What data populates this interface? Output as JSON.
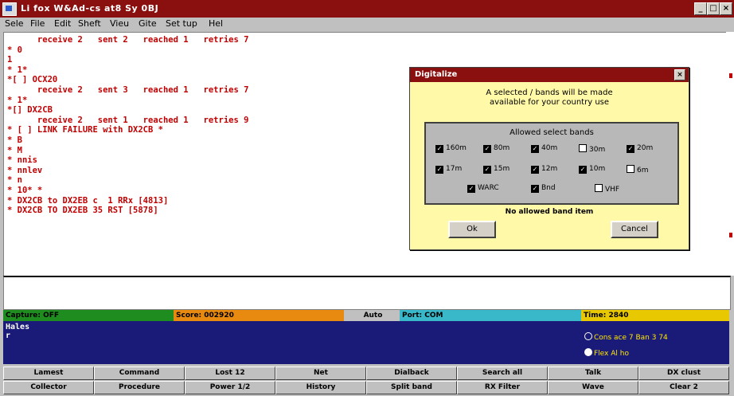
{
  "window": {
    "title": "Li fox W&Ad-cs at8 Sy 0BJ",
    "controls": [
      "_",
      "□",
      "×"
    ]
  },
  "menu": [
    "Sele",
    "File",
    "Edit",
    "Sheft",
    "Vieu",
    "Gite",
    "Set tup",
    "Hel"
  ],
  "editor": {
    "lines": [
      "      receive 2   sent 2   reached 1   retries 7",
      "* 0",
      "1",
      "* 1*",
      "*[ ] OCX20",
      "      receive 2   sent 3   reached 1   retries 7",
      "* 1*",
      "*[] DX2CB",
      "      receive 2   sent 1   reached 1   retries 9",
      "* [ ] LINK FAILURE with DX2CB *",
      "* B",
      "* M",
      "* nnis",
      "* nnlev",
      "* n",
      "* 10* *",
      "* DX2CB to DX2EB c  1 RRx [4813]",
      "* DX2CB TO DX2EB 35 RST [5878]"
    ]
  },
  "dialog": {
    "title": "Digitalize",
    "close": "×",
    "message_line1": "A selected / bands will be made",
    "message_line2": "available for your country use",
    "group_label": "Allowed select bands",
    "row1": [
      {
        "label": "160m",
        "checked": true
      },
      {
        "label": "80m",
        "checked": true
      },
      {
        "label": "40m",
        "checked": true
      },
      {
        "label": "30m",
        "checked": false
      },
      {
        "label": "20m",
        "checked": true
      }
    ],
    "row2": [
      {
        "label": "17m",
        "checked": true
      },
      {
        "label": "15m",
        "checked": true
      },
      {
        "label": "12m",
        "checked": true
      },
      {
        "label": "10m",
        "checked": true
      },
      {
        "label": "6m",
        "checked": false
      }
    ],
    "row3": [
      {
        "label": "WARC",
        "checked": true
      },
      {
        "label": "Bnd",
        "checked": true
      },
      {
        "label": "VHF",
        "checked": false
      }
    ],
    "footer": "No allowed band item",
    "ok_label": "Ok",
    "cancel_label": "Cancel"
  },
  "statusbar": {
    "capture": "Capture: OFF",
    "score": "Score: 002920",
    "mode": "Auto",
    "port": "Port: COM",
    "time": "Time: 2840",
    "colors": {
      "capture": "#1e8c1e",
      "score": "#e88a10",
      "mode": "#c0c0c0",
      "port": "#38b8c8",
      "time": "#e8c800"
    }
  },
  "lower": {
    "lines": [
      "Hales",
      "r"
    ]
  },
  "side": {
    "radio1": "Cons ace 7 Ban 3 74",
    "radio2": "Flex Al ho"
  },
  "fkeys_row1": [
    "Lamest",
    "Command",
    "Lost 12",
    "Net",
    "Dialback",
    "Search all",
    "Talk",
    "DX clust"
  ],
  "fkeys_row2": [
    "Collector",
    "Procedure",
    "Power 1/2",
    "History",
    "Split band",
    "RX Filter",
    "Wave",
    "Clear 2"
  ]
}
